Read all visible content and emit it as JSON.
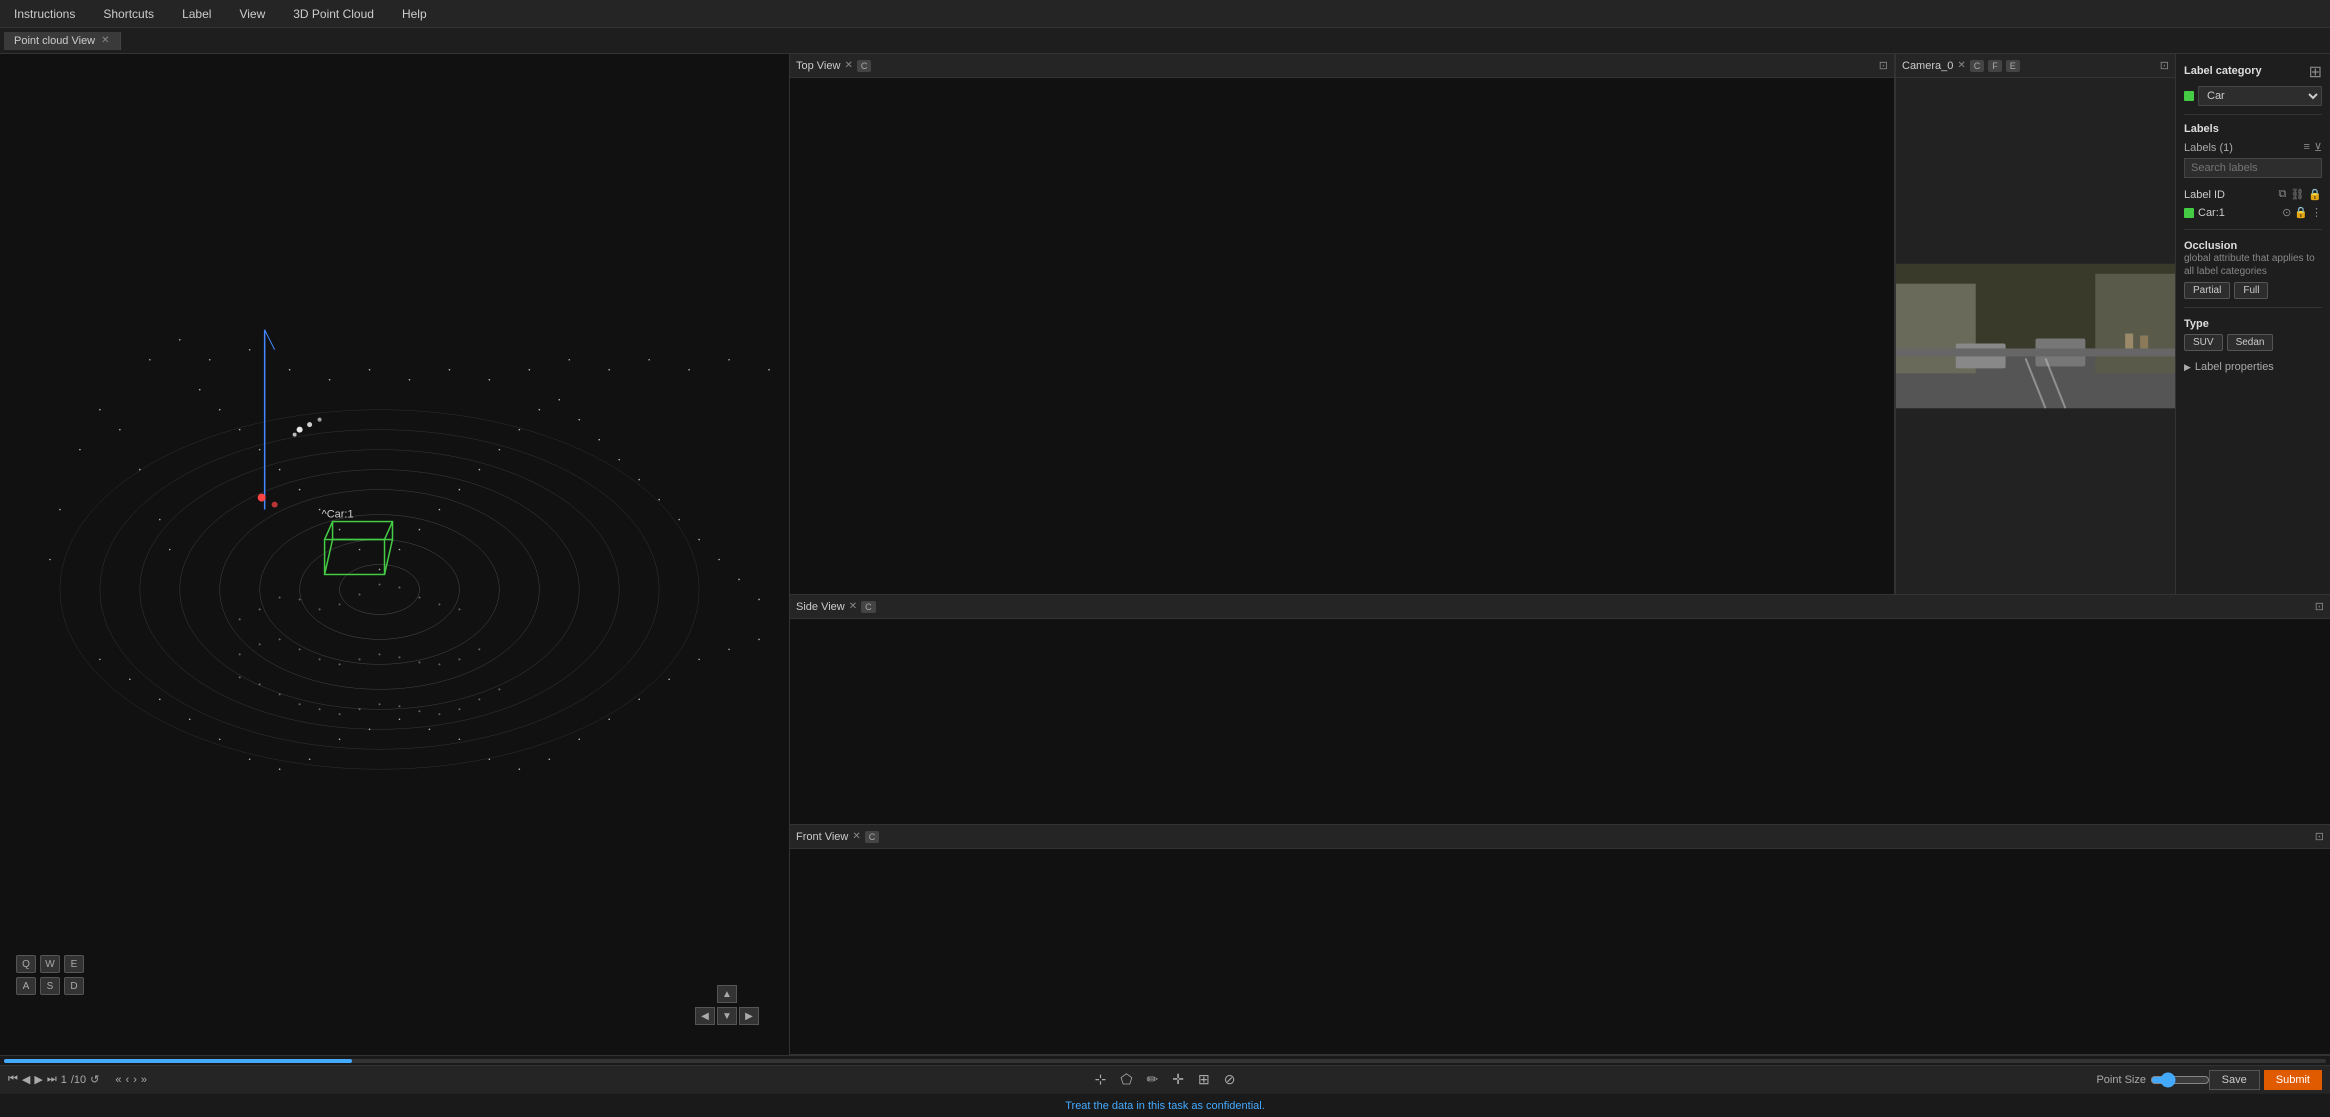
{
  "menubar": {
    "items": [
      "Instructions",
      "Shortcuts",
      "Label",
      "View",
      "3D Point Cloud",
      "Help"
    ]
  },
  "tabs": {
    "active": "Point cloud View",
    "items": [
      {
        "label": "Point cloud View",
        "closable": true
      }
    ]
  },
  "pointCloudView": {
    "label": "^Car:1",
    "keyboard_keys_row1": [
      "Q",
      "W",
      "E"
    ],
    "keyboard_keys_row2": [
      "A",
      "S",
      "D"
    ]
  },
  "topView": {
    "title": "Top View",
    "badge": "C"
  },
  "sideView": {
    "title": "Side View",
    "badge": "C"
  },
  "frontView": {
    "title": "Front View",
    "badge": "C"
  },
  "cameraView": {
    "title": "Camera_0",
    "badges": [
      "C",
      "F",
      "E"
    ]
  },
  "labelPanel": {
    "category_title": "Label category",
    "category_value": "Car",
    "labels_title": "Labels",
    "labels_count_label": "Labels (1)",
    "search_placeholder": "Search labels",
    "label_id_title": "Label ID",
    "label_id_value": "Car:1",
    "occlusion_title": "Occlusion",
    "occlusion_desc": "global attribute that applies to all label categories",
    "occlusion_partial": "Partial",
    "occlusion_full": "Full",
    "type_title": "Type",
    "type_suv": "SUV",
    "type_sedan": "Sedan",
    "label_props": "Label properties"
  },
  "toolbar": {
    "point_size_label": "Point Size",
    "save_label": "Save",
    "submit_label": "Submit",
    "frame_current": "1",
    "frame_total": "/10"
  },
  "confidenceBar": {
    "message": "Treat the data in this task as confidential."
  }
}
